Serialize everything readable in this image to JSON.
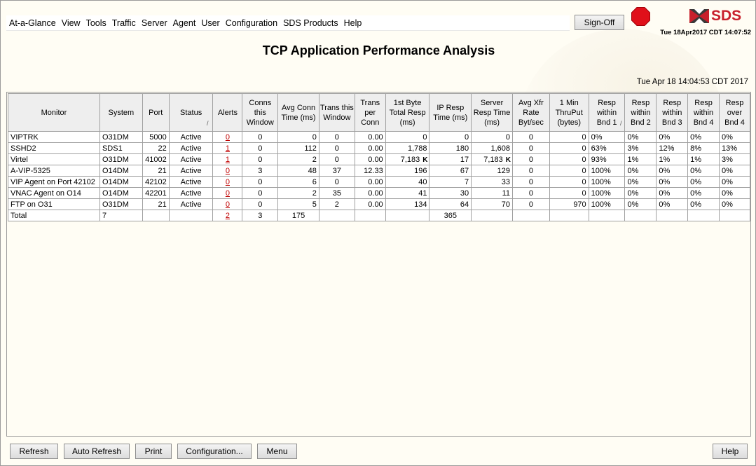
{
  "menu": [
    "At-a-Glance",
    "View",
    "Tools",
    "Traffic",
    "Server",
    "Agent",
    "User",
    "Configuration",
    "SDS Products",
    "Help"
  ],
  "signoff_label": "Sign-Off",
  "logo_text": "SDS",
  "clock": "Tue 18Apr2017 CDT 14:07:52",
  "title": "TCP Application Performance Analysis",
  "timestamp": "Tue Apr 18 14:04:53 CDT 2017",
  "columns": [
    "Monitor",
    "System",
    "Port",
    "Status",
    "Alerts",
    "Conns this Window",
    "Avg Conn Time (ms)",
    "Trans this Window",
    "Trans per Conn",
    "1st Byte Total Resp (ms)",
    "IP Resp Time (ms)",
    "Server Resp Time (ms)",
    "Avg Xfr Rate Byt/sec",
    "1 Min ThruPut (bytes)",
    "Resp within Bnd 1",
    "Resp within Bnd 2",
    "Resp within Bnd 3",
    "Resp within Bnd 4",
    "Resp over Bnd 4"
  ],
  "rows": [
    {
      "monitor": "VIPTRK",
      "system": "O31DM",
      "port": "5000",
      "status": "Active",
      "alerts": "0",
      "conns": "0",
      "avg_conn": "0",
      "trans": "0",
      "trans_per": "0.00",
      "first_byte": "0",
      "fb_flag": "",
      "ip_resp": "0",
      "server_resp": "0",
      "sr_flag": "",
      "xfr_rate": "0",
      "thruput": "0",
      "b1": "0%",
      "b2": "0%",
      "b3": "0%",
      "b4": "0%",
      "over": "0%"
    },
    {
      "monitor": "SSHD2",
      "system": "SDS1",
      "port": "22",
      "status": "Active",
      "alerts": "1",
      "conns": "0",
      "avg_conn": "112",
      "trans": "0",
      "trans_per": "0.00",
      "first_byte": "1,788",
      "fb_flag": "",
      "ip_resp": "180",
      "server_resp": "1,608",
      "sr_flag": "",
      "xfr_rate": "0",
      "thruput": "0",
      "b1": "63%",
      "b2": "3%",
      "b3": "12%",
      "b4": "8%",
      "over": "13%"
    },
    {
      "monitor": "Virtel",
      "system": "O31DM",
      "port": "41002",
      "status": "Active",
      "alerts": "1",
      "conns": "0",
      "avg_conn": "2",
      "trans": "0",
      "trans_per": "0.00",
      "first_byte": "7,183",
      "fb_flag": "K",
      "ip_resp": "17",
      "server_resp": "7,183",
      "sr_flag": "K",
      "xfr_rate": "0",
      "thruput": "0",
      "b1": "93%",
      "b2": "1%",
      "b3": "1%",
      "b4": "1%",
      "over": "3%"
    },
    {
      "monitor": "A-VIP-5325",
      "system": "O14DM",
      "port": "21",
      "status": "Active",
      "alerts": "0",
      "conns": "3",
      "avg_conn": "48",
      "trans": "37",
      "trans_per": "12.33",
      "first_byte": "196",
      "fb_flag": "",
      "ip_resp": "67",
      "server_resp": "129",
      "sr_flag": "",
      "xfr_rate": "0",
      "thruput": "0",
      "b1": "100%",
      "b2": "0%",
      "b3": "0%",
      "b4": "0%",
      "over": "0%"
    },
    {
      "monitor": "VIP Agent on Port 42102",
      "system": "O14DM",
      "port": "42102",
      "status": "Active",
      "alerts": "0",
      "conns": "0",
      "avg_conn": "6",
      "trans": "0",
      "trans_per": "0.00",
      "first_byte": "40",
      "fb_flag": "",
      "ip_resp": "7",
      "server_resp": "33",
      "sr_flag": "",
      "xfr_rate": "0",
      "thruput": "0",
      "b1": "100%",
      "b2": "0%",
      "b3": "0%",
      "b4": "0%",
      "over": "0%"
    },
    {
      "monitor": "VNAC Agent on O14",
      "system": "O14DM",
      "port": "42201",
      "status": "Active",
      "alerts": "0",
      "conns": "0",
      "avg_conn": "2",
      "trans": "35",
      "trans_per": "0.00",
      "first_byte": "41",
      "fb_flag": "",
      "ip_resp": "30",
      "server_resp": "11",
      "sr_flag": "",
      "xfr_rate": "0",
      "thruput": "0",
      "b1": "100%",
      "b2": "0%",
      "b3": "0%",
      "b4": "0%",
      "over": "0%"
    },
    {
      "monitor": "FTP on O31",
      "system": "O31DM",
      "port": "21",
      "status": "Active",
      "alerts": "0",
      "conns": "0",
      "avg_conn": "5",
      "trans": "2",
      "trans_per": "0.00",
      "first_byte": "134",
      "fb_flag": "",
      "ip_resp": "64",
      "server_resp": "70",
      "sr_flag": "",
      "xfr_rate": "0",
      "thruput": "970",
      "b1": "100%",
      "b2": "0%",
      "b3": "0%",
      "b4": "0%",
      "over": "0%"
    }
  ],
  "total": {
    "label": "Total",
    "system": "7",
    "alerts": "2",
    "conns": "3",
    "avg_conn": "175",
    "ip_resp": "365"
  },
  "buttons": {
    "refresh": "Refresh",
    "auto_refresh": "Auto Refresh",
    "print": "Print",
    "configuration": "Configuration...",
    "menu": "Menu",
    "help": "Help"
  },
  "colors": {
    "alert_link": "#c00000",
    "logo_red": "#c8202c",
    "stop_red": "#e0101a",
    "header_bg": "#eeeeee"
  }
}
